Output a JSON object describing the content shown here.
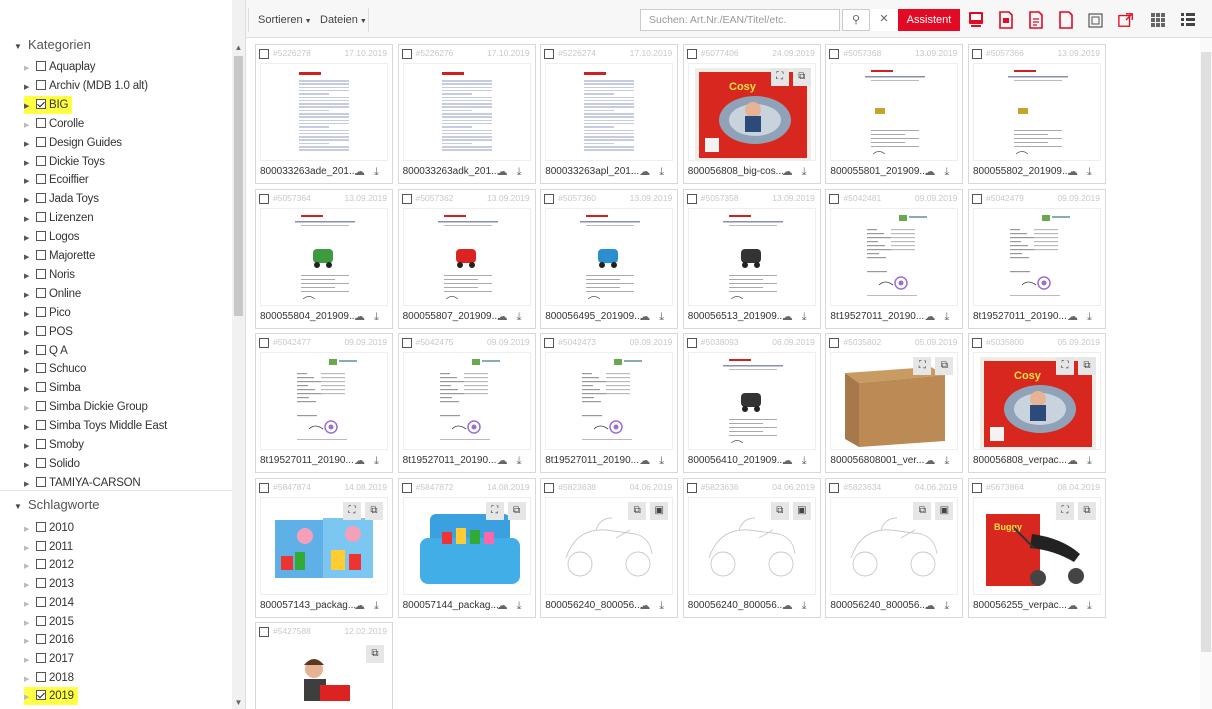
{
  "toolbar": {
    "sort_label": "Sortieren",
    "files_label": "Dateien",
    "search_placeholder": "Suchen: Art.Nr./EAN/Titel/etc.",
    "search_icon": "🔍",
    "clear_icon": "✕",
    "assistant_label": "Assistent",
    "accent": "#e30b24"
  },
  "sidebar": {
    "categories_title": "Kategorien",
    "categories": [
      {
        "label": "Aquaplay",
        "expand": "light",
        "checked": false,
        "hl": false
      },
      {
        "label": "Archiv (MDB 1.0 alt)",
        "expand": "dark",
        "checked": false,
        "hl": false
      },
      {
        "label": "BIG",
        "expand": "dark",
        "checked": true,
        "hl": true
      },
      {
        "label": "Corolle",
        "expand": "light",
        "checked": false,
        "hl": false
      },
      {
        "label": "Design Guides",
        "expand": "dark",
        "checked": false,
        "hl": false
      },
      {
        "label": "Dickie Toys",
        "expand": "dark",
        "checked": false,
        "hl": false
      },
      {
        "label": "Ecoiffier",
        "expand": "dark",
        "checked": false,
        "hl": false
      },
      {
        "label": "Jada Toys",
        "expand": "dark",
        "checked": false,
        "hl": false
      },
      {
        "label": "Lizenzen",
        "expand": "dark",
        "checked": false,
        "hl": false
      },
      {
        "label": "Logos",
        "expand": "dark",
        "checked": false,
        "hl": false
      },
      {
        "label": "Majorette",
        "expand": "dark",
        "checked": false,
        "hl": false
      },
      {
        "label": "Noris",
        "expand": "dark",
        "checked": false,
        "hl": false
      },
      {
        "label": "Online",
        "expand": "dark",
        "checked": false,
        "hl": false
      },
      {
        "label": "Pico",
        "expand": "dark",
        "checked": false,
        "hl": false
      },
      {
        "label": "POS",
        "expand": "dark",
        "checked": false,
        "hl": false
      },
      {
        "label": "Q A",
        "expand": "dark",
        "checked": false,
        "hl": false
      },
      {
        "label": "Schuco",
        "expand": "dark",
        "checked": false,
        "hl": false
      },
      {
        "label": "Simba",
        "expand": "dark",
        "checked": false,
        "hl": false
      },
      {
        "label": "Simba Dickie Group",
        "expand": "light",
        "checked": false,
        "hl": false
      },
      {
        "label": "Simba Toys Middle East",
        "expand": "dark",
        "checked": false,
        "hl": false
      },
      {
        "label": "Smoby",
        "expand": "dark",
        "checked": false,
        "hl": false
      },
      {
        "label": "Solido",
        "expand": "dark",
        "checked": false,
        "hl": false
      },
      {
        "label": "TAMIYA-CARSON",
        "expand": "dark",
        "checked": false,
        "hl": false
      }
    ],
    "keywords_title": "Schlagworte",
    "keywords": [
      {
        "label": "2010",
        "checked": false,
        "hl": false
      },
      {
        "label": "2011",
        "checked": false,
        "hl": false
      },
      {
        "label": "2012",
        "checked": false,
        "hl": false
      },
      {
        "label": "2013",
        "checked": false,
        "hl": false
      },
      {
        "label": "2014",
        "checked": false,
        "hl": false
      },
      {
        "label": "2015",
        "checked": false,
        "hl": false
      },
      {
        "label": "2016",
        "checked": false,
        "hl": false
      },
      {
        "label": "2017",
        "checked": false,
        "hl": false
      },
      {
        "label": "2018",
        "checked": false,
        "hl": false
      },
      {
        "label": "2019",
        "checked": true,
        "hl": true
      }
    ]
  },
  "assets": [
    {
      "id": "#5226278",
      "date": "17.10.2019",
      "name": "800033263ade_201...",
      "kind": "doc",
      "ov": []
    },
    {
      "id": "#5226276",
      "date": "17.10.2019",
      "name": "800033263adk_201...",
      "kind": "doc",
      "ov": []
    },
    {
      "id": "#5226274",
      "date": "17.10.2019",
      "name": "800033263apl_201...",
      "kind": "doc",
      "ov": []
    },
    {
      "id": "#5077406",
      "date": "24.09.2019",
      "name": "800056808_big-cos...",
      "kind": "cosy",
      "ov": [
        "crop",
        "ext"
      ]
    },
    {
      "id": "#5057368",
      "date": "13.09.2019",
      "name": "800055801_201909...",
      "kind": "sheet",
      "ov": []
    },
    {
      "id": "#5057366",
      "date": "13.09.2019",
      "name": "800055802_201909...",
      "kind": "sheet",
      "ov": []
    },
    {
      "id": "#5057364",
      "date": "13.09.2019",
      "name": "800055804_201909...",
      "kind": "sheet-green",
      "ov": []
    },
    {
      "id": "#5057362",
      "date": "13.09.2019",
      "name": "800055807_201909...",
      "kind": "sheet-red",
      "ov": []
    },
    {
      "id": "#5057360",
      "date": "13.09.2019",
      "name": "800056495_201909...",
      "kind": "sheet-blue",
      "ov": []
    },
    {
      "id": "#5057358",
      "date": "13.09.2019",
      "name": "800056513_201909...",
      "kind": "sheet-dark",
      "ov": []
    },
    {
      "id": "#5042481",
      "date": "09.09.2019",
      "name": "8t19527011_20190...",
      "kind": "cert",
      "ov": []
    },
    {
      "id": "#5042479",
      "date": "09.09.2019",
      "name": "8t19527011_20190...",
      "kind": "cert",
      "ov": []
    },
    {
      "id": "#5042477",
      "date": "09.09.2019",
      "name": "8t19527011_20190...",
      "kind": "cert",
      "ov": []
    },
    {
      "id": "#5042475",
      "date": "09.09.2019",
      "name": "8t19527011_20190...",
      "kind": "cert",
      "ov": []
    },
    {
      "id": "#5042473",
      "date": "09.09.2019",
      "name": "8t19527011_20190...",
      "kind": "cert",
      "ov": []
    },
    {
      "id": "#5038093",
      "date": "06.09.2019",
      "name": "800056410_201909...",
      "kind": "sheet-dark",
      "ov": []
    },
    {
      "id": "#5035802",
      "date": "05.09.2019",
      "name": "800056808001_ver...",
      "kind": "box",
      "ov": [
        "crop",
        "ext"
      ]
    },
    {
      "id": "#5035800",
      "date": "05.09.2019",
      "name": "800056808_verpac...",
      "kind": "cosy",
      "ov": [
        "crop",
        "ext"
      ]
    },
    {
      "id": "#5847874",
      "date": "14.08.2019",
      "name": "800057143_packag...",
      "kind": "pack",
      "ov": [
        "crop",
        "ext"
      ]
    },
    {
      "id": "#5847872",
      "date": "14.08.2019",
      "name": "800057144_packag...",
      "kind": "case",
      "ov": [
        "crop",
        "ext"
      ]
    },
    {
      "id": "#5823638",
      "date": "04.06.2019",
      "name": "800056240_800056...",
      "kind": "sketch",
      "ov": [
        "ext",
        "img"
      ]
    },
    {
      "id": "#5823636",
      "date": "04.06.2019",
      "name": "800056240_800056...",
      "kind": "sketch",
      "ov": [
        "ext",
        "img"
      ]
    },
    {
      "id": "#5823634",
      "date": "04.06.2019",
      "name": "800056240_800056...",
      "kind": "sketch",
      "ov": [
        "ext",
        "img"
      ]
    },
    {
      "id": "#5673864",
      "date": "08.04.2019",
      "name": "800056255_verpac...",
      "kind": "buggy",
      "ov": [
        "crop",
        "ext"
      ]
    },
    {
      "id": "#5427588",
      "date": "12.02.2019",
      "name": "",
      "kind": "kid",
      "ov": [
        "ext"
      ]
    }
  ]
}
